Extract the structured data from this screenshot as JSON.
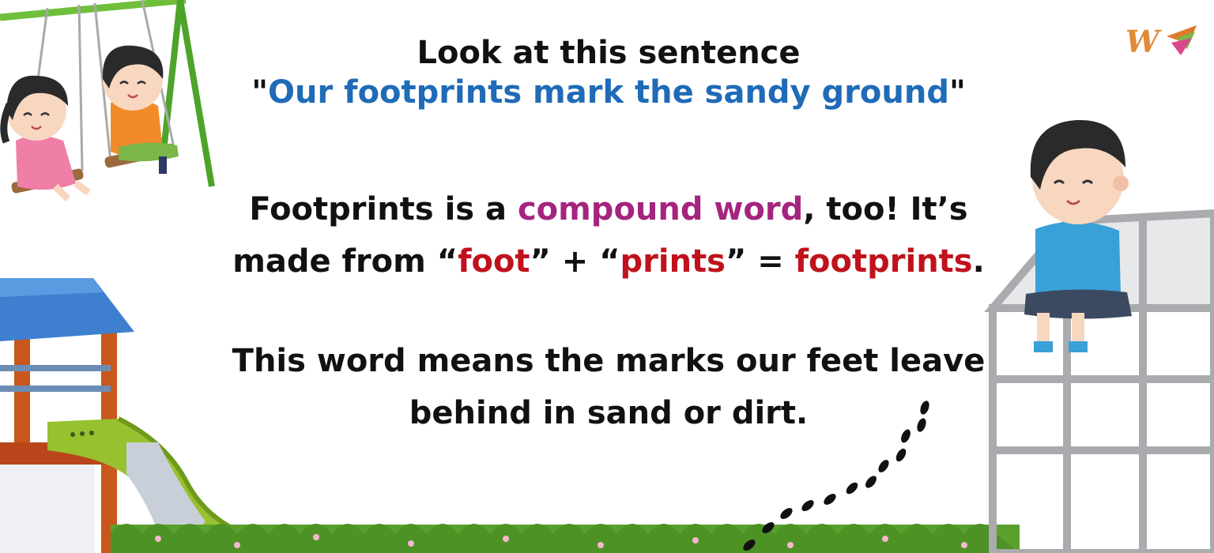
{
  "heading": {
    "line1": "Look at this sentence",
    "quote_open": "\"",
    "sentence": "Our footprints mark the sandy ground",
    "quote_close": "\""
  },
  "para1": {
    "t1": "Footprints is a ",
    "compound": "compound word",
    "t2": ", too! It’s",
    "t3": "made from “",
    "foot": "foot",
    "t4": "” + “",
    "prints": "prints",
    "t5": "” = ",
    "result": "footprints",
    "t6": "."
  },
  "para2": {
    "line1": "This word means the marks our feet leave",
    "line2": "behind in sand or dirt."
  },
  "logo": {
    "text": "W"
  },
  "colors": {
    "blue": "#1f6bb7",
    "purple": "#a4247e",
    "red": "#c0121c",
    "grass": "#5aa02c",
    "roof": "#3f7fd0",
    "slide": "#97c12e"
  }
}
